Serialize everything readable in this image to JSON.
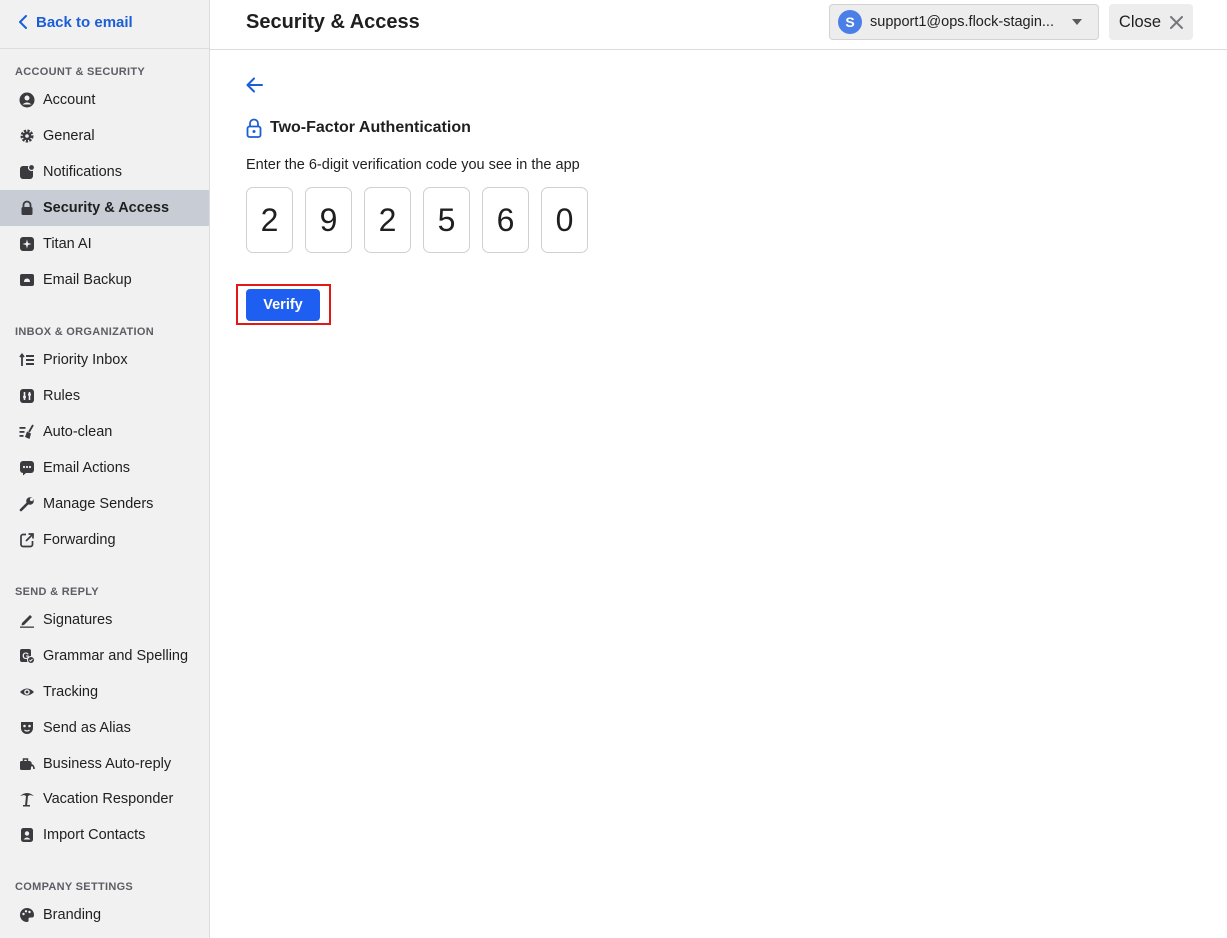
{
  "sidebar": {
    "back_label": "Back to email",
    "sections": [
      {
        "title": "ACCOUNT & SECURITY",
        "items": [
          {
            "label": "Account",
            "icon": "account-icon"
          },
          {
            "label": "General",
            "icon": "gear-icon"
          },
          {
            "label": "Notifications",
            "icon": "notifications-icon"
          },
          {
            "label": "Security & Access",
            "icon": "lock-icon",
            "active": true
          },
          {
            "label": "Titan AI",
            "icon": "sparkle-icon"
          },
          {
            "label": "Email Backup",
            "icon": "backup-icon"
          }
        ]
      },
      {
        "title": "INBOX & ORGANIZATION",
        "items": [
          {
            "label": "Priority Inbox",
            "icon": "priority-icon"
          },
          {
            "label": "Rules",
            "icon": "rules-icon"
          },
          {
            "label": "Auto-clean",
            "icon": "broom-icon"
          },
          {
            "label": "Email Actions",
            "icon": "actions-icon"
          },
          {
            "label": "Manage Senders",
            "icon": "wrench-icon"
          },
          {
            "label": "Forwarding",
            "icon": "forward-icon"
          }
        ]
      },
      {
        "title": "SEND & REPLY",
        "items": [
          {
            "label": "Signatures",
            "icon": "pen-icon"
          },
          {
            "label": "Grammar and Spelling",
            "icon": "grammar-icon"
          },
          {
            "label": "Tracking",
            "icon": "eye-icon"
          },
          {
            "label": "Send as Alias",
            "icon": "mask-icon"
          },
          {
            "label": "Business Auto-reply",
            "icon": "briefcase-reply-icon"
          },
          {
            "label": "Vacation Responder",
            "icon": "palm-tree-icon"
          },
          {
            "label": "Import Contacts",
            "icon": "contacts-icon"
          }
        ]
      },
      {
        "title": "COMPANY SETTINGS",
        "items": [
          {
            "label": "Branding",
            "icon": "palette-icon"
          }
        ]
      }
    ]
  },
  "header": {
    "title": "Security & Access",
    "account": {
      "avatar_letter": "S",
      "email": "support1@ops.flock-stagin..."
    },
    "close_label": "Close"
  },
  "main": {
    "tfa_title": "Two-Factor Authentication",
    "instructions": "Enter the 6-digit verification code you see in the app",
    "code": [
      "2",
      "9",
      "2",
      "5",
      "6",
      "0"
    ],
    "verify_label": "Verify"
  },
  "colors": {
    "accent": "#1e5ff1",
    "link": "#1b5fd6",
    "highlight": "#e01818",
    "sidebar_bg": "#f1f1f2",
    "active_bg": "#c8ccd4"
  }
}
